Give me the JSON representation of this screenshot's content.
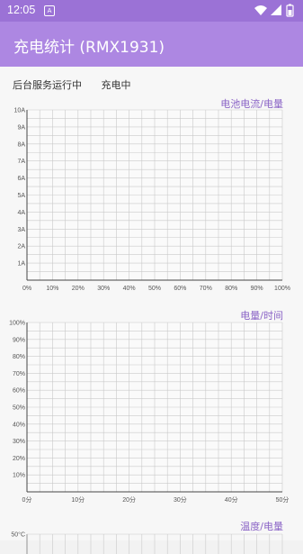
{
  "status_bar": {
    "time": "12:05",
    "notification_icon": "A"
  },
  "app": {
    "title": "充电统计 (RMX1931)"
  },
  "status": {
    "service": "后台服务运行中",
    "charging": "充电中"
  },
  "colors": {
    "accent": "#ad87e2",
    "status_bar": "#9b72d6",
    "title_text": "#8a63c6"
  },
  "chart_data": [
    {
      "type": "line",
      "title": "电池电流/电量",
      "x_ticks": [
        "0%",
        "10%",
        "20%",
        "30%",
        "40%",
        "50%",
        "60%",
        "70%",
        "80%",
        "90%",
        "100%"
      ],
      "y_ticks": [
        "1A",
        "2A",
        "3A",
        "4A",
        "5A",
        "6A",
        "7A",
        "8A",
        "9A",
        "10A"
      ],
      "xlim": [
        0,
        100
      ],
      "ylim": [
        0,
        10
      ],
      "series": []
    },
    {
      "type": "line",
      "title": "电量/时间",
      "x_ticks": [
        "0分",
        "10分",
        "20分",
        "30分",
        "40分",
        "50分"
      ],
      "y_ticks": [
        "10%",
        "20%",
        "30%",
        "40%",
        "50%",
        "60%",
        "70%",
        "80%",
        "90%",
        "100%"
      ],
      "xlim": [
        0,
        50
      ],
      "ylim": [
        0,
        100
      ],
      "series": []
    },
    {
      "type": "line",
      "title": "温度/电量",
      "y_ticks": [
        "50°C"
      ],
      "series": []
    }
  ]
}
